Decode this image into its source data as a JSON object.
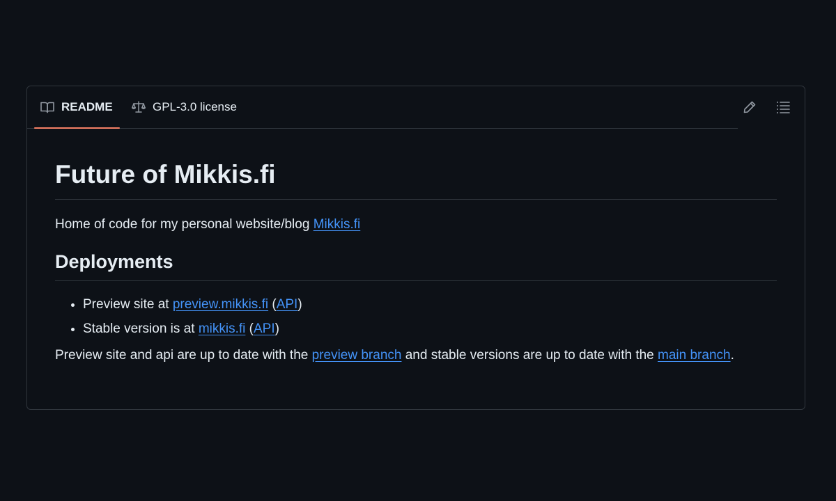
{
  "tabs": {
    "readme_label": "README",
    "license_label": "GPL-3.0 license"
  },
  "icons": {
    "readme": "book-icon",
    "license": "law-scale-icon",
    "edit": "pencil-icon",
    "outline": "list-unordered-icon"
  },
  "colors": {
    "background": "#0d1117",
    "border": "#30363d",
    "text": "#e6edf3",
    "link": "#4493f8",
    "tab_underline": "#f78166",
    "icon": "#9198a1"
  },
  "readme": {
    "title": "Future of Mikkis.fi",
    "intro_text": "Home of code for my personal website/blog ",
    "intro_link": "Mikkis.fi",
    "deployments_heading": "Deployments",
    "deployments": [
      {
        "prefix": "Preview site at ",
        "link": "preview.mikkis.fi",
        "paren_open": " (",
        "api_link": "API",
        "paren_close": ")"
      },
      {
        "prefix": "Stable version is at ",
        "link": "mikkis.fi",
        "paren_open": " (",
        "api_link": "API",
        "paren_close": ")"
      }
    ],
    "final_text_1": "Preview site and api are up to date with the ",
    "final_link_1": "preview branch",
    "final_text_2": " and stable versions are up to date with the ",
    "final_link_2": "main branch",
    "final_text_3": "."
  }
}
